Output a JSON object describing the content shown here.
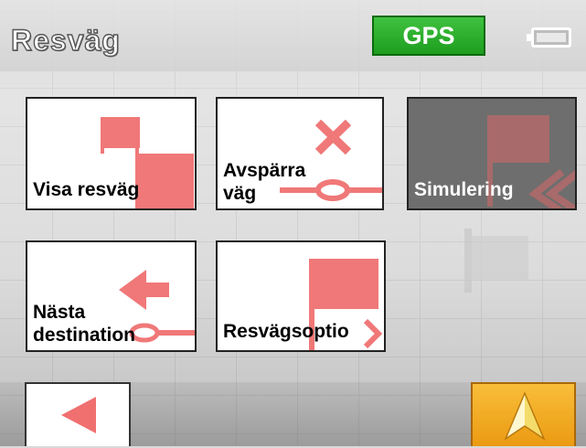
{
  "header": {
    "title": "Resväg",
    "gps_label": "GPS"
  },
  "icons": {
    "battery": "battery-icon",
    "back": "left-arrow-icon",
    "navigate": "navigation-arrow-icon"
  },
  "tiles": [
    {
      "label": "Visa resväg",
      "icon": "route-flags-icon",
      "state": "enabled"
    },
    {
      "label_line1": "Avspärra",
      "label_line2": "väg",
      "icon": "block-road-icon",
      "state": "enabled"
    },
    {
      "label": "Simulering",
      "icon": "simulation-icon",
      "state": "disabled"
    },
    {
      "label_line1": "Nästa",
      "label_line2": "destination",
      "icon": "next-destination-icon",
      "state": "enabled"
    },
    {
      "label": "Resvägsoptio",
      "icon": "route-options-icon",
      "state": "enabled"
    }
  ],
  "colors": {
    "gps_green": "#2fb02f",
    "icon_red": "#f07878",
    "nav_orange": "#f2a825",
    "disabled_tile": "#6e6e6e"
  }
}
